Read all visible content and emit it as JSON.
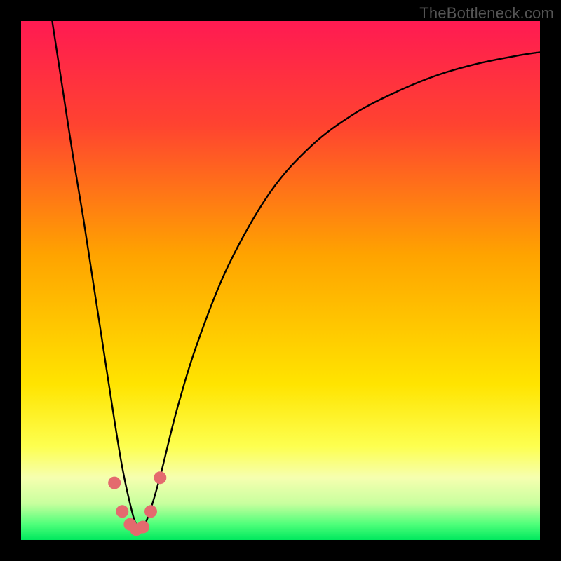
{
  "attribution": "TheBottleneck.com",
  "chart_data": {
    "type": "line",
    "title": "",
    "xlabel": "",
    "ylabel": "",
    "xlim": [
      0,
      1
    ],
    "ylim": [
      0,
      1
    ],
    "gradient_stops": [
      {
        "offset": 0.0,
        "color": "#ff1a52"
      },
      {
        "offset": 0.2,
        "color": "#ff4330"
      },
      {
        "offset": 0.45,
        "color": "#ffa300"
      },
      {
        "offset": 0.7,
        "color": "#ffe400"
      },
      {
        "offset": 0.82,
        "color": "#fdff50"
      },
      {
        "offset": 0.88,
        "color": "#f6ffb0"
      },
      {
        "offset": 0.93,
        "color": "#c8ff9e"
      },
      {
        "offset": 0.97,
        "color": "#4eff7a"
      },
      {
        "offset": 1.0,
        "color": "#00e85e"
      }
    ],
    "series": [
      {
        "name": "curve",
        "x": [
          0.06,
          0.08,
          0.1,
          0.12,
          0.14,
          0.16,
          0.18,
          0.195,
          0.21,
          0.222,
          0.235,
          0.25,
          0.27,
          0.3,
          0.34,
          0.4,
          0.48,
          0.56,
          0.64,
          0.72,
          0.8,
          0.88,
          0.96,
          1.0
        ],
        "y": [
          1.0,
          0.87,
          0.74,
          0.62,
          0.49,
          0.36,
          0.23,
          0.14,
          0.07,
          0.03,
          0.025,
          0.06,
          0.13,
          0.25,
          0.38,
          0.53,
          0.67,
          0.76,
          0.82,
          0.862,
          0.895,
          0.918,
          0.934,
          0.94
        ]
      }
    ],
    "marker_points": {
      "x": [
        0.18,
        0.195,
        0.21,
        0.222,
        0.235,
        0.25,
        0.268
      ],
      "y": [
        0.11,
        0.055,
        0.03,
        0.02,
        0.025,
        0.055,
        0.12
      ],
      "color": "#e46a6e",
      "radius": 9
    }
  }
}
